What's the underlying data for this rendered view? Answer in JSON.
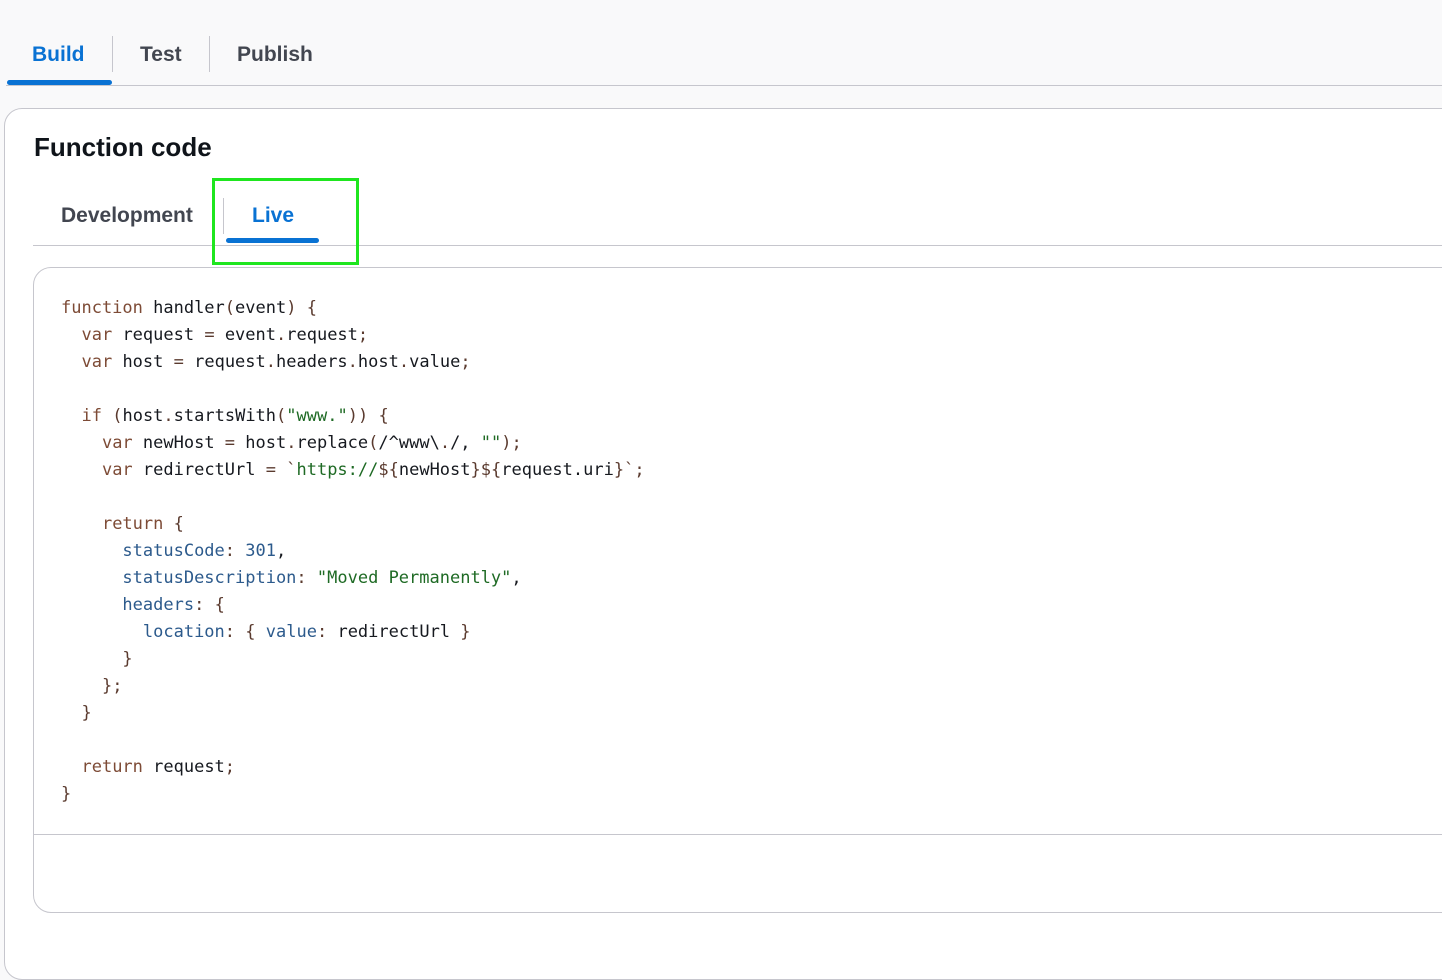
{
  "top_tabs": {
    "build": "Build",
    "test": "Test",
    "publish": "Publish",
    "active": "Build"
  },
  "panel": {
    "title": "Function code"
  },
  "code_tabs": {
    "development": "Development",
    "live": "Live",
    "active": "Live"
  },
  "code": {
    "language": "javascript",
    "lines": [
      "function handler(event) {",
      "  var request = event.request;",
      "  var host = request.headers.host.value;",
      "",
      "  if (host.startsWith(\"www.\")) {",
      "    var newHost = host.replace(/^www\\./, \"\");",
      "    var redirectUrl = `https://${newHost}${request.uri}`;",
      "",
      "    return {",
      "      statusCode: 301,",
      "      statusDescription: \"Moved Permanently\",",
      "      headers: {",
      "        location: { value: redirectUrl }",
      "      }",
      "    };",
      "  }",
      "",
      "  return request;",
      "}"
    ]
  },
  "colors": {
    "accent": "#0972d3",
    "highlight": "#1fe61f",
    "keyword": "#7d4b36",
    "string": "#1e6a24",
    "property": "#2c5a8c"
  }
}
